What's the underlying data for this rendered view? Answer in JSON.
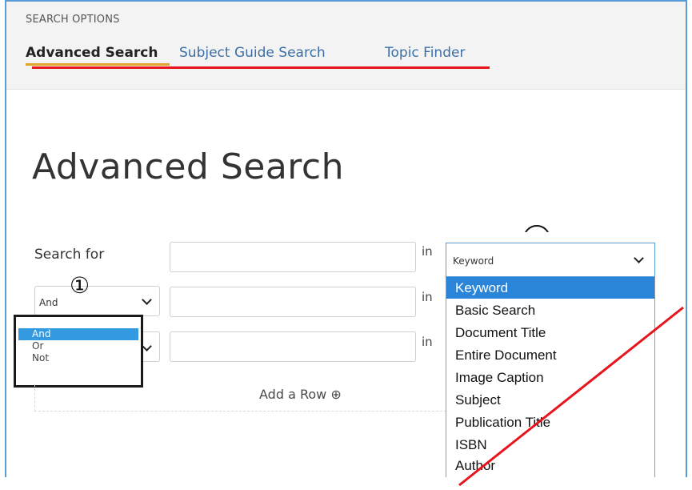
{
  "header": {
    "section_label": "SEARCH OPTIONS",
    "tabs": [
      {
        "label": "Advanced Search",
        "active": true
      },
      {
        "label": "Subject Guide Search",
        "active": false
      },
      {
        "label": "Topic Finder",
        "active": false
      }
    ]
  },
  "main": {
    "title": "Advanced Search",
    "search_for_label": "Search for",
    "in_label": "in",
    "bool_select_value": "And",
    "bool_options": [
      "And",
      "Or",
      "Not"
    ],
    "add_row_label": "Add a Row ⊕",
    "field_select_value": "Keyword",
    "field_options": [
      "Keyword",
      "Basic Search",
      "Document Title",
      "Entire Document",
      "Image Caption",
      "Subject",
      "Publication Title",
      "ISBN",
      "Author"
    ]
  },
  "annotations": {
    "marker_1": "①"
  },
  "colors": {
    "accent_underline": "#e0a32c",
    "annotation_red": "#e8141c",
    "link_blue": "#3d6fa6",
    "selected_blue": "#2a85d8"
  }
}
